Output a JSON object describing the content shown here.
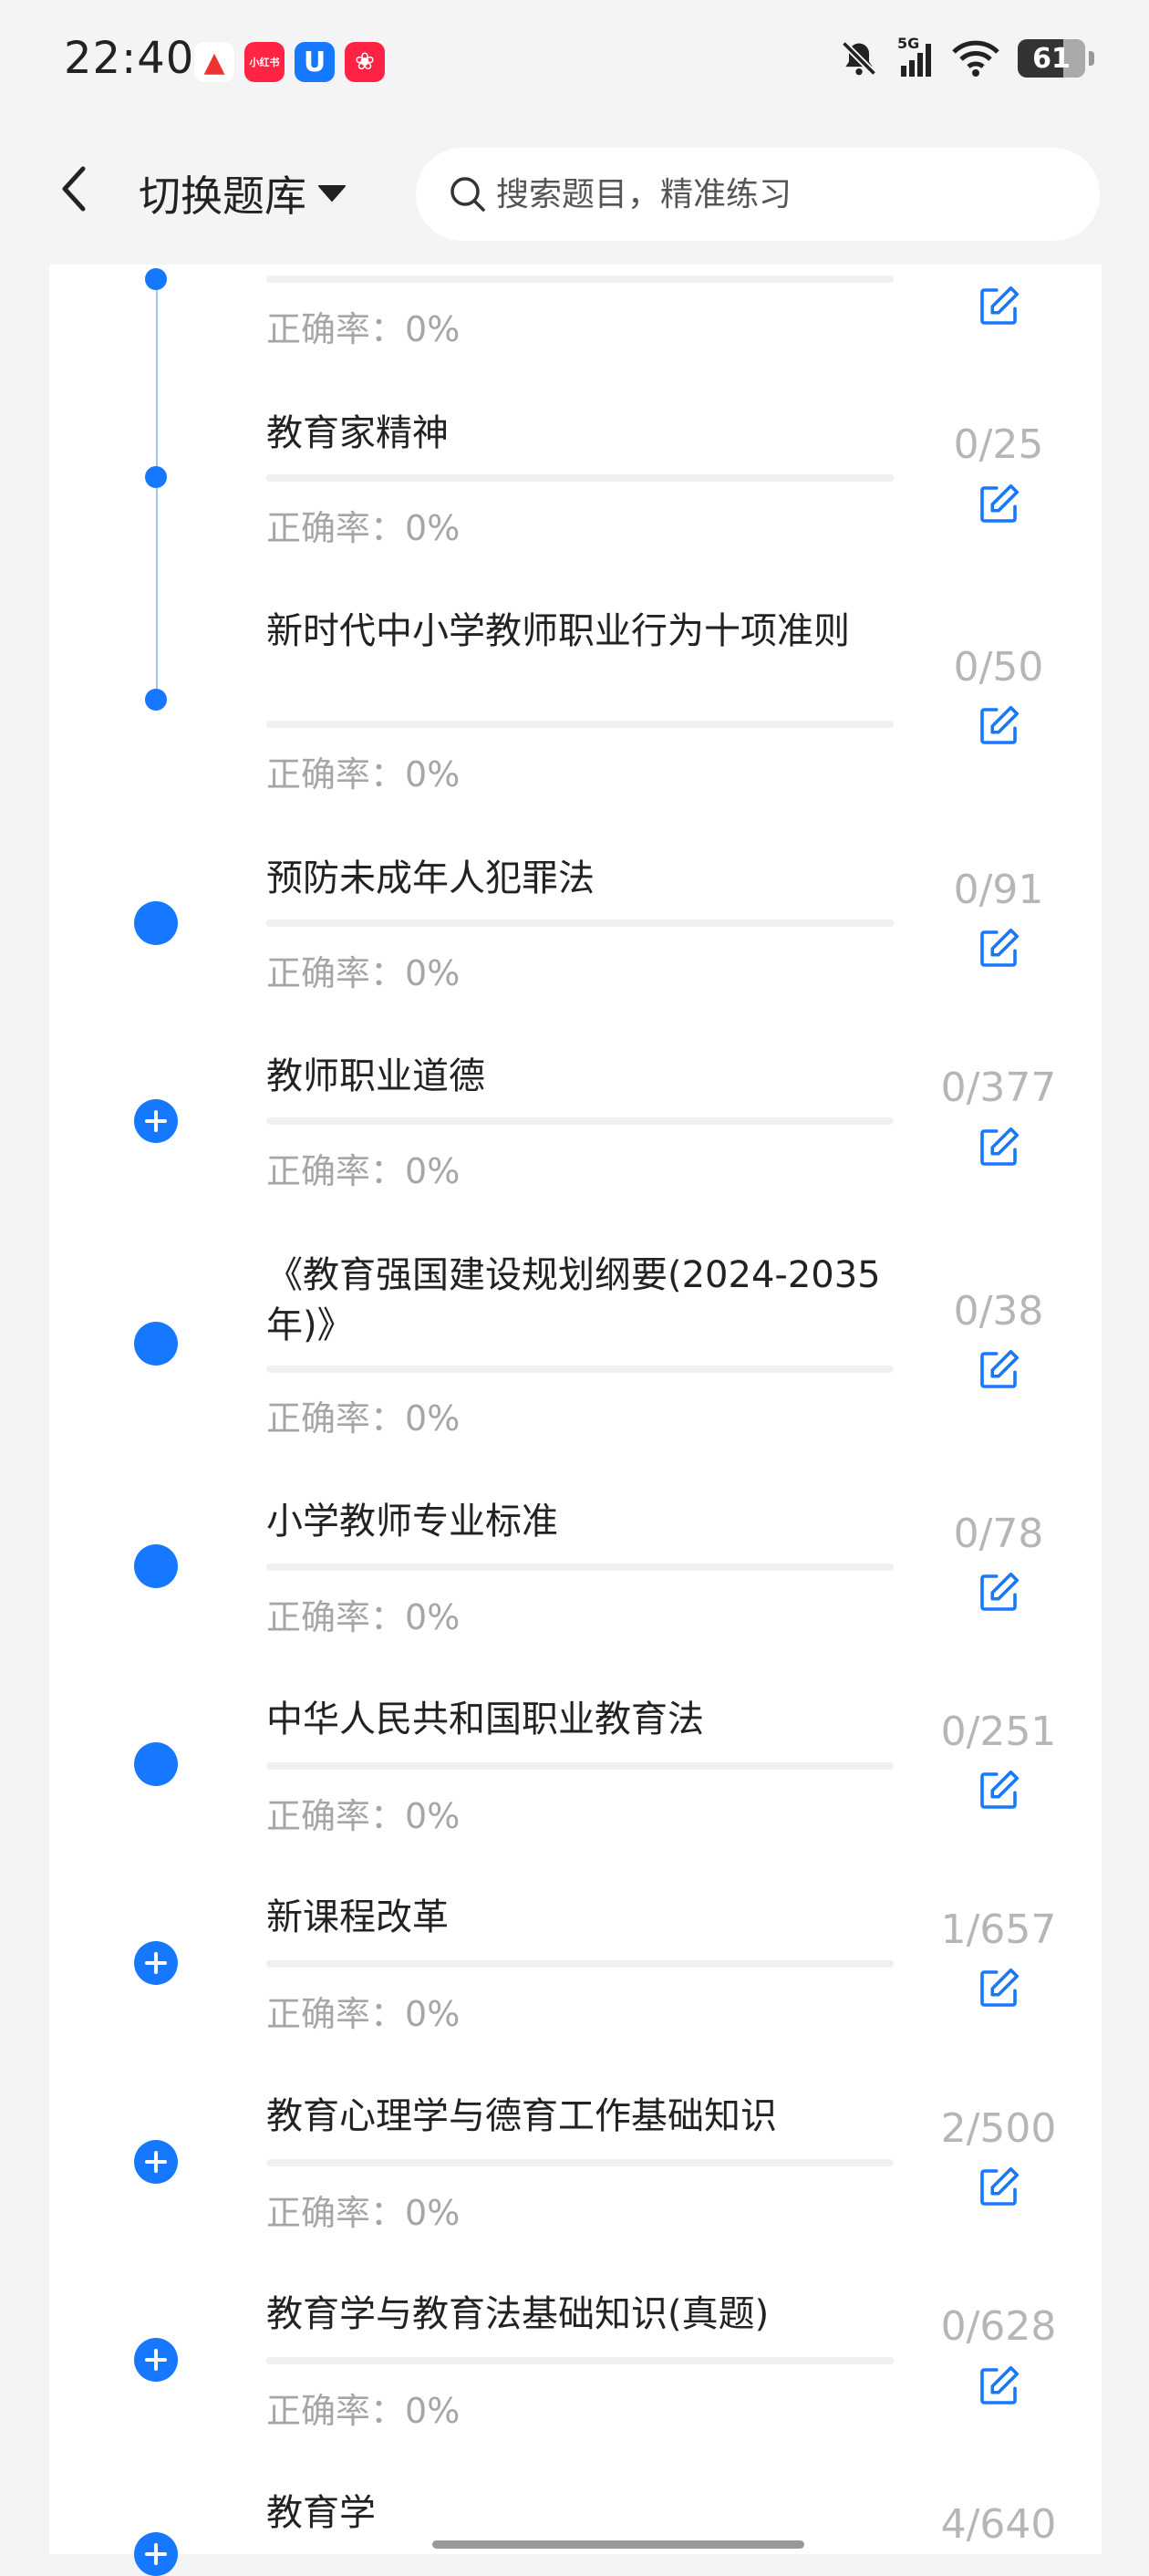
{
  "status_bar": {
    "time": "22:40",
    "battery": "61",
    "network": "5G",
    "icons": [
      "bell-muted-icon",
      "signal-icon",
      "wifi-icon",
      "battery-icon"
    ],
    "app_icons": [
      "app-icon-red-triangle",
      "xiaohongshu-icon",
      "blue-u-app-icon",
      "red-app-icon"
    ],
    "xiaohongshu_label": "小红书"
  },
  "header": {
    "switch_label": "切换题库",
    "search_placeholder": "搜索题目，精准练习"
  },
  "accuracy_label": "正确率：",
  "items": [
    {
      "title": "",
      "accuracy": "0%",
      "count": "",
      "marker": "small"
    },
    {
      "title": "教育家精神",
      "accuracy": "0%",
      "count": "0/25",
      "marker": "small"
    },
    {
      "title": "新时代中小学教师职业行为十项准则",
      "accuracy": "0%",
      "count": "0/50",
      "marker": "small"
    },
    {
      "title": "预防未成年人犯罪法",
      "accuracy": "0%",
      "count": "0/91",
      "marker": "dot"
    },
    {
      "title": "教师职业道德",
      "accuracy": "0%",
      "count": "0/377",
      "marker": "plus"
    },
    {
      "title": "《教育强国建设规划纲要(2024-2035年)》",
      "accuracy": "0%",
      "count": "0/38",
      "marker": "dot"
    },
    {
      "title": "小学教师专业标准",
      "accuracy": "0%",
      "count": "0/78",
      "marker": "dot"
    },
    {
      "title": "中华人民共和国职业教育法",
      "accuracy": "0%",
      "count": "0/251",
      "marker": "dot"
    },
    {
      "title": "新课程改革",
      "accuracy": "0%",
      "count": "1/657",
      "marker": "plus"
    },
    {
      "title": "教育心理学与德育工作基础知识",
      "accuracy": "0%",
      "count": "2/500",
      "marker": "plus"
    },
    {
      "title": "教育学与教育法基础知识(真题)",
      "accuracy": "0%",
      "count": "0/628",
      "marker": "plus"
    },
    {
      "title": "教育学",
      "accuracy": "",
      "count": "4/640",
      "marker": "plus"
    }
  ],
  "colors": {
    "accent": "#1677ff",
    "timeline": "#9cc4f3",
    "muted_text": "#a6a6a6",
    "count_text": "#b6b6b6",
    "background": "#f4f4f6"
  }
}
